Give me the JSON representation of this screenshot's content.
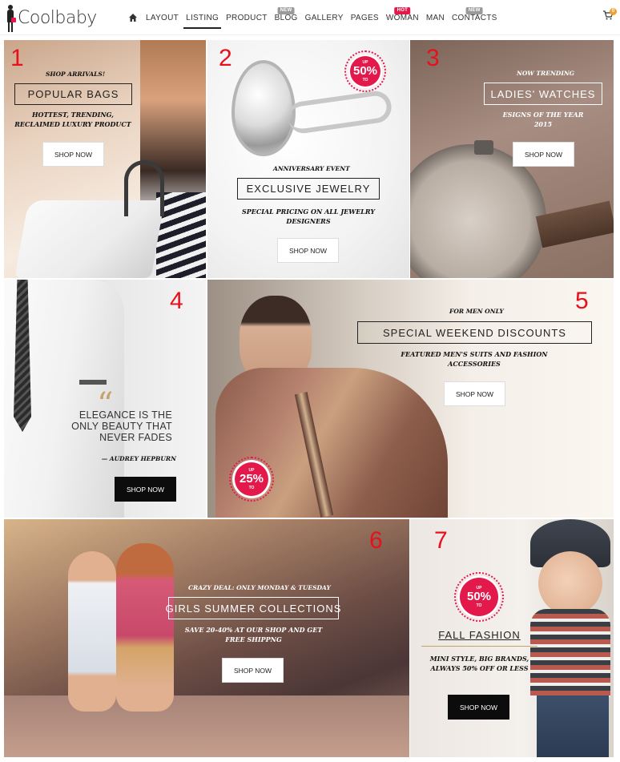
{
  "header": {
    "logo_text": "Coolbaby",
    "nav": [
      {
        "label": "LAYOUT",
        "badge": ""
      },
      {
        "label": "LISTING",
        "badge": ""
      },
      {
        "label": "PRODUCT",
        "badge": ""
      },
      {
        "label": "BLOG",
        "badge": "NEW"
      },
      {
        "label": "GALLERY",
        "badge": ""
      },
      {
        "label": "PAGES",
        "badge": ""
      },
      {
        "label": "WOMAN",
        "badge": "HOT"
      },
      {
        "label": "MAN",
        "badge": ""
      },
      {
        "label": "CONTACTS",
        "badge": "NEW"
      }
    ],
    "active_item": "LISTING",
    "cart_count": "0",
    "home_icon": "home-icon",
    "cart_icon": "cart-icon"
  },
  "colors": {
    "accent": "#e4194b",
    "number_red": "#e8101a",
    "badge_grey": "#9a9a9a"
  },
  "tiles": {
    "t1": {
      "number": "1",
      "eyebrow": "SHOP ARRIVALS!",
      "heading": "POPULAR BAGS",
      "subtext": "HOTTEST, TRENDING, RECLAIMED LUXURY PRODUCT",
      "button": "SHOP NOW"
    },
    "t2": {
      "number": "2",
      "badge_up": "UP",
      "badge_value": "50%",
      "badge_to": "TO",
      "eyebrow": "ANNIVERSARY EVENT",
      "heading": "EXCLUSIVE JEWELRY",
      "subtext": "SPECIAL PRICING ON ALL JEWELRY DESIGNERS",
      "button": "SHOP NOW"
    },
    "t3": {
      "number": "3",
      "eyebrow": "NOW TRENDING",
      "heading": "LADIES' WATCHES",
      "subtext": "ESIGNS OF THE YEAR 2015",
      "button": "SHOP NOW"
    },
    "t4": {
      "number": "4",
      "quote_mark": "“",
      "quote": "ELEGANCE IS THE ONLY BEAUTY THAT NEVER FADES",
      "author": "— AUDREY HEPBURN",
      "button": "SHOP NOW"
    },
    "t5": {
      "number": "5",
      "eyebrow": "FOR MEN ONLY",
      "heading": "SPECIAL WEEKEND DISCOUNTS",
      "subtext": "FEATURED MEN'S SUITS AND FASHION ACCESSORIES",
      "button": "SHOP NOW",
      "badge_up": "UP",
      "badge_value": "25%",
      "badge_to": "TO"
    },
    "t6": {
      "number": "6",
      "eyebrow": "CRAZY DEAL: ONLY MONDAY & TUESDAY",
      "heading": "GIRLS SUMMER COLLECTIONS",
      "subtext": "SAVE 20-40% AT OUR SHOP AND GET FREE SHIPPNG",
      "button": "SHOP NOW"
    },
    "t7": {
      "number": "7",
      "badge_up": "UP",
      "badge_value": "50%",
      "badge_to": "TO",
      "heading": "FALL FASHION",
      "subtext": "MINI STYLE, BIG BRANDS, ALWAYS 50% OFF OR LESS",
      "button": "SHOP NOW"
    }
  }
}
